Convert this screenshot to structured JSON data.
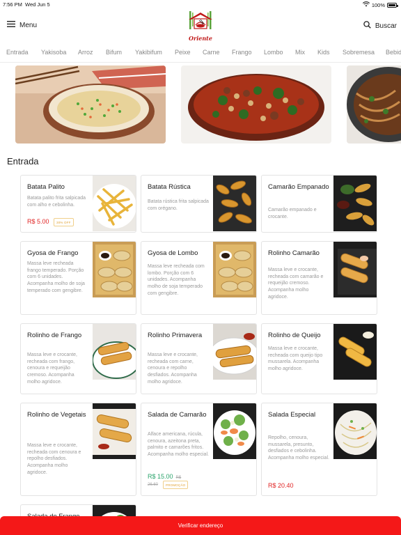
{
  "status_bar": {
    "time": "7:56 PM",
    "date": "Wed Jun 5",
    "battery": "100%",
    "battery_level": 1.0
  },
  "header": {
    "menu_label": "Menu",
    "search_label": "Buscar",
    "logo_text": "Oriente"
  },
  "categories": [
    "Entrada",
    "Yakisoba",
    "Arroz",
    "Bifum",
    "Yakibifum",
    "Peixe",
    "Carne",
    "Frango",
    "Lombo",
    "Mix",
    "Kids",
    "Sobremesa",
    "Bebidas"
  ],
  "section": {
    "title": "Entrada"
  },
  "products": [
    {
      "name": "Batata Palito",
      "description": "Batata palito frita salpicada com alho e cebolinha.",
      "price": "R$ 5.00",
      "badge": "30% OFF"
    },
    {
      "name": "Batata Rústica",
      "description": "Batata rústica frita salpicada com orégano."
    },
    {
      "name": "Camarão Empanado",
      "description": "Camarão empanado e crocante."
    },
    {
      "name": "Gyosa de Frango",
      "description": "Massa leve recheada frango temperado. Porção com 6 unidades. Acompanha molho de soja temperado com gengibre."
    },
    {
      "name": "Gyosa de Lombo",
      "description": "Massa leve recheada com lombo. Porção com 6 unidades. Acompanha molho de soja temperado com gengibre."
    },
    {
      "name": "Rolinho Camarão",
      "description": "Massa leve e crocante, recheada com camarão e requeijão cremoso. Acompanha molho agridoce."
    },
    {
      "name": "Rolinho de Frango",
      "description": "Massa leve e crocante, recheada com frango, cenoura e requeijão cremoso. Acompanha molho agridoce."
    },
    {
      "name": "Rolinho Primavera",
      "description": "Massa leve e crocante, recheada com carne, cenoura e repolho desfiados. Acompanha molho agridoce."
    },
    {
      "name": "Rolinho de Queijo",
      "description": "Massa leve e crocante, recheada com queijo tipo mussarela. Acompanha molho agridoce."
    },
    {
      "name": "Rolinho de Vegetais",
      "description": "Massa leve e crocante, recheada com cenoura e repolho desfiados. Acompanha molho agridoce."
    },
    {
      "name": "Salada de Camarão",
      "description": "Alface americana, rúcula, cenoura, azeitona preta, palmito e camarões fritos. Acompanha molho especial.",
      "price": "R$ 15.00",
      "old_price": "R$ 26.60",
      "badge": "PROMOÇÃO"
    },
    {
      "name": "Salada Especial",
      "description": "Repolho, cenoura, mussarela, presunto, desfiados e cebolinha. Acompanha molho especial.",
      "price": "R$ 20.40"
    },
    {
      "name": "Salada de Frango"
    }
  ],
  "bottom_bar": {
    "label": "Verificar endereço"
  },
  "colors": {
    "accent": "#f41818",
    "price_red": "#e02424",
    "price_green": "#2aa36b",
    "badge": "#e0a030"
  },
  "icons": {
    "menu": "hamburger-icon",
    "search": "search-icon",
    "wifi": "wifi-icon",
    "battery": "battery-icon"
  }
}
